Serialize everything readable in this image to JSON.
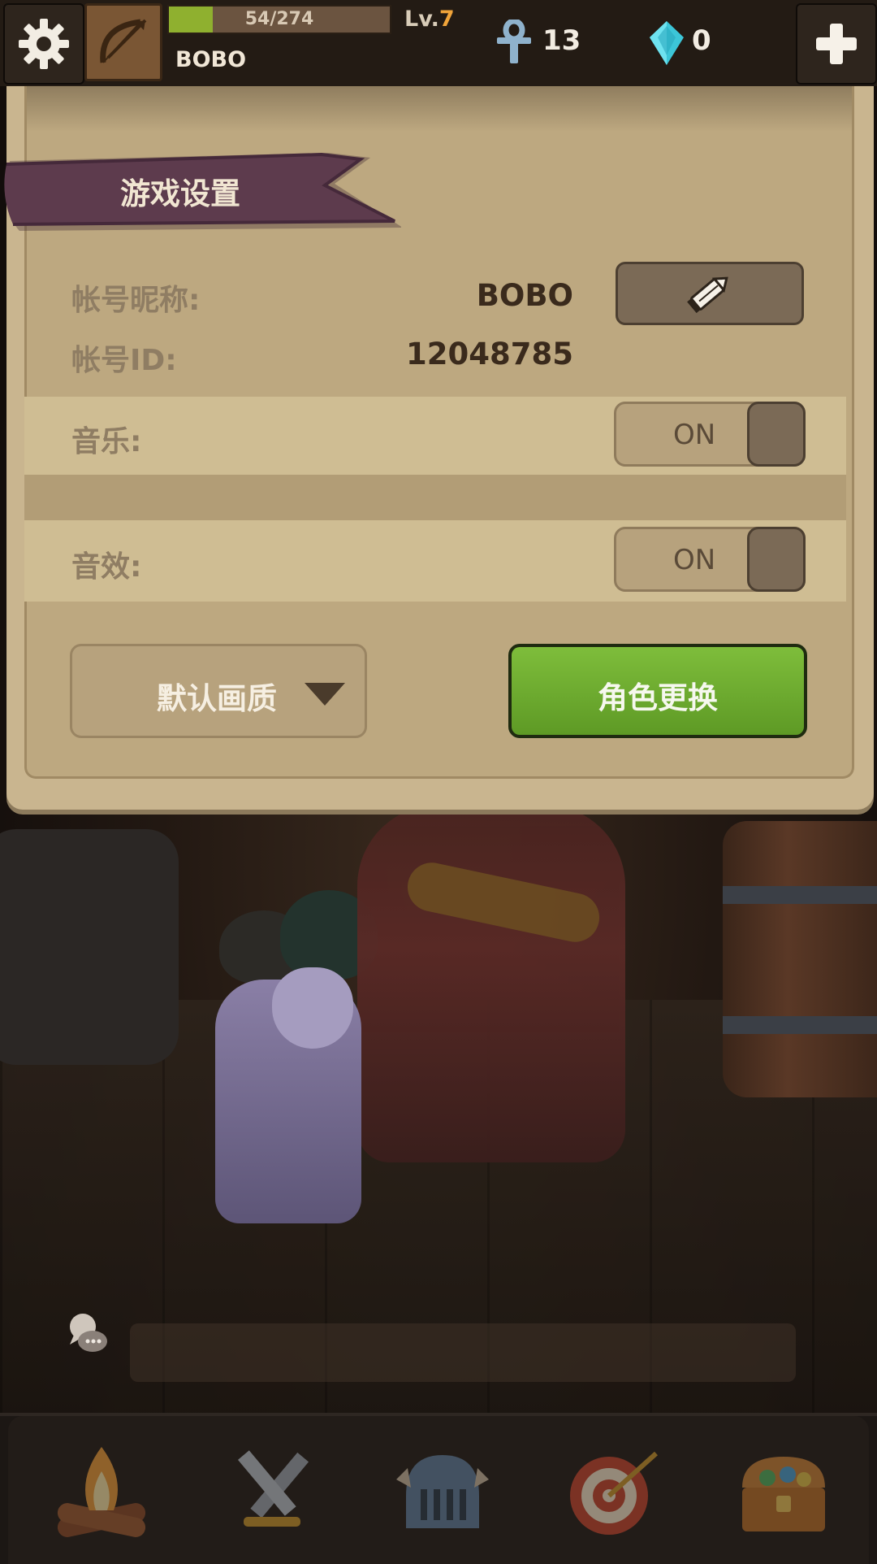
{
  "topbar": {
    "xp_text": "54/274",
    "xp_fraction": 0.197,
    "username": "BOBO",
    "level_prefix": "Lv.",
    "level": "7",
    "ankh_count": "13",
    "gem_count": "0"
  },
  "settings": {
    "title": "游戏设置",
    "nickname_label": "帐号昵称:",
    "nickname_value": "BOBO",
    "id_label": "帐号ID:",
    "id_value": "12048785",
    "music_label": "音乐:",
    "music_state": "ON",
    "sfx_label": "音效:",
    "sfx_state": "ON",
    "quality_label": "默认画质",
    "role_change_label": "角色更换"
  },
  "colors": {
    "xp_fill": "#8fb02f",
    "level_accent": "#f0a43a",
    "green_button": "#6fae30",
    "ribbon": "#5a3a4a",
    "panel": "#bda880"
  },
  "icons": {
    "settings": "gear-icon",
    "avatar": "bow-icon",
    "currency1": "ankh-icon",
    "currency2": "gem-icon",
    "add": "plus-icon",
    "edit": "pencil-icon",
    "chat": "chat-icon",
    "nav": [
      "campfire-icon",
      "crossed-swords-icon",
      "helmet-icon",
      "target-icon",
      "treasure-chest-icon"
    ]
  }
}
